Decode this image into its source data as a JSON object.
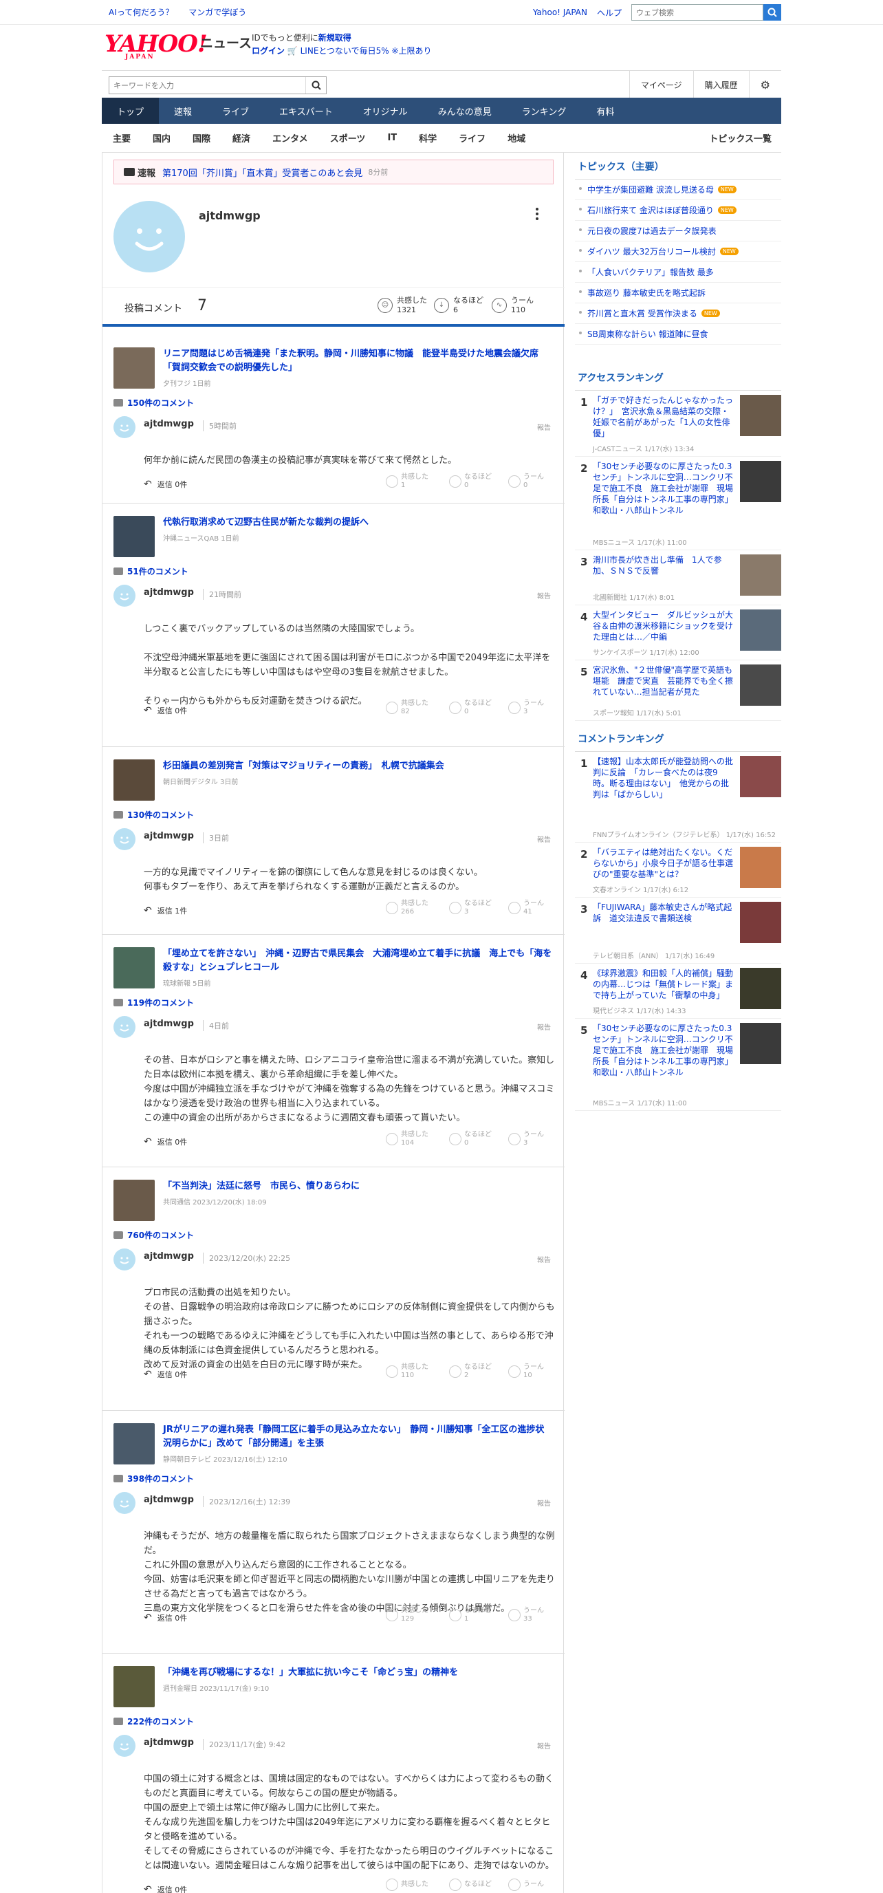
{
  "top": {
    "left_links": [
      "AIって何だろう？",
      "マンガで学ぼう"
    ],
    "right_links": [
      "Yahoo! JAPAN",
      "ヘルプ"
    ],
    "web_search_placeholder": "ウェブ検索"
  },
  "header": {
    "logo": "YAHOO!",
    "logo_sub": "JAPAN",
    "section": "ニュース",
    "promo1_a": "IDでもっと便利に",
    "promo1_b": "新規取得",
    "promo2_a": "ログイン",
    "promo2_b": "LINEとつないで毎日5% ※上限あり"
  },
  "search": {
    "placeholder": "キーワードを入力",
    "links": [
      "マイページ",
      "購入履歴"
    ]
  },
  "nav": [
    "トップ",
    "速報",
    "ライブ",
    "エキスパート",
    "オリジナル",
    "みんなの意見",
    "ランキング",
    "有料"
  ],
  "subnav": [
    "主要",
    "国内",
    "国際",
    "経済",
    "エンタメ",
    "スポーツ",
    "IT",
    "科学",
    "ライフ",
    "地域"
  ],
  "subnav_more": "トピックス一覧",
  "breaking": {
    "tag": "速報",
    "title": "第170回「芥川賞」「直木賞」受賞者このあと会見",
    "time": "8分前"
  },
  "profile": {
    "name": "ajtdmwgp"
  },
  "stats": {
    "label": "投稿コメント",
    "count": "7",
    "reactions": [
      {
        "label": "共感した",
        "value": "1321"
      },
      {
        "label": "なるほど",
        "value": "6"
      },
      {
        "label": "うーん",
        "value": "110"
      }
    ]
  },
  "reaction_labels": {
    "agree": "共感した",
    "naruhodo": "なるほど",
    "hmm": "うーん",
    "report": "報告"
  },
  "cards": [
    {
      "title": "リニア問題はじめ舌禍連発「また釈明。静岡・川勝知事に物議　能登半島受けた地震会議欠席「賀詞交歓会での説明優先した」",
      "source": "夕刊フジ  1日前",
      "comments": "150件のコメント",
      "user": "ajtdmwgp",
      "time": "5時間前",
      "body": "何年か前に読んだ民団の魯漢主の投稿記事が真実味を帯びて来て愕然とした。",
      "reply": "返信 0件",
      "r1": "1",
      "r2": "0",
      "r3": "0"
    },
    {
      "title": "代執行取消求めて辺野古住民が新たな裁判の提訴へ",
      "source": "沖縄ニュースQAB  1日前",
      "comments": "51件のコメント",
      "user": "ajtdmwgp",
      "time": "21時間前",
      "body": "しつこく裏でバックアップしているのは当然隣の大陸国家でしょう。\n\n不沈空母沖縄米軍基地を更に強固にされて困る国は利害がモロにぶつかる中国で2049年迄に太平洋を半分取ると公言したにも等しい中国はもはや空母の3隻目を就航させました。\n\nそりゃー内からも外からも反対運動を焚きつける訳だ。",
      "reply": "返信 0件",
      "r1": "82",
      "r2": "0",
      "r3": "3"
    },
    {
      "title": "杉田議員の差別発言「対策はマジョリティーの責務」　札幌で抗議集会",
      "source": "朝日新聞デジタル  3日前",
      "comments": "130件のコメント",
      "user": "ajtdmwgp",
      "time": "3日前",
      "body": "一方的な見識でマイノリティーを錦の御旗にして色んな意見を封じるのは良くない。\n何事もタブーを作り、あえて声を挙げられなくする運動が正義だと言えるのか。",
      "reply": "返信 1件",
      "r1": "266",
      "r2": "3",
      "r3": "41"
    },
    {
      "title": "「埋め立てを許さない」　沖縄・辺野古で県民集会　大浦湾埋め立て着手に抗議　海上でも「海を殺すな」とシュプレヒコール",
      "source": "琉球新報  5日前",
      "comments": "119件のコメント",
      "user": "ajtdmwgp",
      "time": "4日前",
      "body": "その昔、日本がロシアと事を構えた時、ロシアニコライ皇帝治世に溜まる不満が充満していた。察知した日本は欧州に本拠を構え、裏から革命組織に手を差し伸べた。\n今度は中国が沖縄独立派を手なづけやがて沖縄を強奪する為の先鋒をつけていると思う。沖縄マスコミはかなり浸透を受け政治の世界も相当に入り込まれている。\nこの連中の資金の出所があからさまになるように週間文春も頑張って貰いたい。",
      "reply": "返信 0件",
      "r1": "104",
      "r2": "0",
      "r3": "3"
    },
    {
      "title": "「不当判決」法廷に怒号　市民ら、憤りあらわに",
      "source": "共同通信  2023/12/20(水) 18:09",
      "comments": "760件のコメント",
      "user": "ajtdmwgp",
      "time": "2023/12/20(水) 22:25",
      "body": "プロ市民の活動費の出処を知りたい。\nその昔、日露戦争の明治政府は帝政ロシアに勝つためにロシアの反体制側に資金提供をして内側からも揺さぶった。\nそれも一つの戦略であるゆえに沖縄をどうしても手に入れたい中国は当然の事として、あらゆる形で沖縄の反体制派には色資金提供しているんだろうと思われる。\n改めて反対派の資金の出処を白日の元に曝す時が来た。",
      "reply": "返信 0件",
      "r1": "110",
      "r2": "2",
      "r3": "10"
    },
    {
      "title": "JRがリニアの遅れ発表「静岡工区に着手の見込み立たない」　静岡・川勝知事「全工区の進捗状況明らかに」改めて「部分開通」を主張",
      "source": "静岡朝日テレビ  2023/12/16(土) 12:10",
      "comments": "398件のコメント",
      "user": "ajtdmwgp",
      "time": "2023/12/16(土) 12:39",
      "body": "沖縄もそうだが、地方の裁量権を盾に取られたら国家プロジェクトさえままならなくしまう典型的な例だ。\nこれに外国の意思が入り込んだら意図的に工作されることとなる。\n今回、妨害は毛沢東を師と仰ぎ習近平と同志の間柄胞たいな川勝が中国との連携し中国リニアを先走りさせる為だと言っても過言ではなかろう。\n三島の東方文化学院をつくると口を滑らせた件を含め後の中国に対する傾倒ぶりは異常だ。",
      "reply": "返信 0件",
      "r1": "129",
      "r2": "1",
      "r3": "33"
    },
    {
      "title": "「沖縄を再び戦場にするな！」大軍拡に抗い今こそ「命どぅ宝」の精神を",
      "source": "週刊金曜日  2023/11/17(金) 9:10",
      "comments": "222件のコメント",
      "user": "ajtdmwgp",
      "time": "2023/11/17(金) 9:42",
      "body": "中国の領土に対する概念とは、国境は固定的なものではない。すべからくは力によって変わるもの動くものだと真面目に考えている。何故ならこの国の歴史が物語る。\n中国の歴史上で領土は常に伸び縮みし国力に比例して来た。\nそんな成り先進国を騙し力をつけた中国は2049年迄にアメリカに変わる覇権を握るべく着々とヒタヒタと侵略を進めている。\nそしてその脅威にさらされているのが沖縄で今、手を打たなかったら明日のウイグルチベットになることは間違いない。週間金曜日はこんな煽り記事を出して彼らは中国の配下にあり、走狗ではないのか。",
      "reply": "返信 0件",
      "r1": "",
      "r2": "",
      "r3": ""
    }
  ],
  "sidebar": {
    "topics_title": "トピックス（主要）",
    "topics": [
      {
        "t": "中学生が集団避難 涙流し見送る母",
        "new": true
      },
      {
        "t": "石川旅行来て 金沢はほぼ普段通り",
        "new": true
      },
      {
        "t": "元日夜の震度7は過去データ誤発表",
        "new": false
      },
      {
        "t": "ダイハツ 最大32万台リコール検討",
        "new": true
      },
      {
        "t": "「人食いバクテリア」報告数 最多",
        "new": false
      },
      {
        "t": "事故巡り 藤本敏史氏を略式起訴",
        "new": false
      },
      {
        "t": "芥川賞と直木賞 受賞作決まる",
        "new": true
      },
      {
        "t": "SB周東称な計らい 報道陣に昼食",
        "new": false
      }
    ],
    "new_label": "NEW",
    "access_title": "アクセスランキング",
    "access": [
      {
        "n": "1",
        "t": "「ガチで好きだったんじゃなかったっけ？」　宮沢氷魚＆黒島結菜の交際・妊娠で名前があがった「1人の女性俳優」",
        "s": "J-CASTニュース  1/17(水) 13:34"
      },
      {
        "n": "2",
        "t": "「30センチ必要なのに厚さたった0.3センチ」トンネルに空洞…コンクリ不足で施工不良　施工会社が謝罪　現場所長「自分はトンネル工事の専門家」和歌山・八郎山トンネル",
        "s": "MBSニュース  1/17(水) 11:00"
      },
      {
        "n": "3",
        "t": "滑川市長が炊き出し準備　1人で参加、ＳＮＳで反響",
        "s": "北國新聞社  1/17(水) 8:01"
      },
      {
        "n": "4",
        "t": "大型インタビュー　ダルビッシュが大谷＆由伸の渡米移籍にショックを受けた理由とは…／中編",
        "s": "サンケイスポーツ  1/17(水) 12:00"
      },
      {
        "n": "5",
        "t": "宮沢氷魚、\"２世俳優\"高学歴で英語も堪能　謙虚で実直　芸能界でも全く擦れていない…担当記者が見た",
        "s": "スポーツ報知  1/17(水) 5:01"
      }
    ],
    "comment_title": "コメントランキング",
    "comment": [
      {
        "n": "1",
        "t": "【速報】山本太郎氏が能登訪問への批判に反論　「カレー食べたのは夜9時。断る理由はない」　他党からの批判は「ばからしい」",
        "s": "FNNプライムオンライン（フジテレビ系）  1/17(水) 16:52"
      },
      {
        "n": "2",
        "t": "「バラエティは絶対出たくない。くだらないから」小泉今日子が語る仕事選びの\"重要な基準\"とは？",
        "s": "文春オンライン  1/17(水) 6:12"
      },
      {
        "n": "3",
        "t": "「FUJIWARA」藤本敏史さんが略式起訴　道交法違反で書類送検",
        "s": "テレビ朝日系（ANN）  1/17(水) 16:49"
      },
      {
        "n": "4",
        "t": "《球界激震》和田毅「人的補償」騒動の内幕…じつは「無償トレード案」まで持ち上がっていた「衝撃の中身」",
        "s": "現代ビジネス  1/17(水) 14:33"
      },
      {
        "n": "5",
        "t": "「30センチ必要なのに厚さたった0.3センチ」トンネルに空洞…コンクリ不足で施工不良　施工会社が謝罪　現場所長「自分はトンネル工事の専門家」和歌山・八郎山トンネル",
        "s": "MBSニュース  1/17(水) 11:00"
      }
    ]
  }
}
